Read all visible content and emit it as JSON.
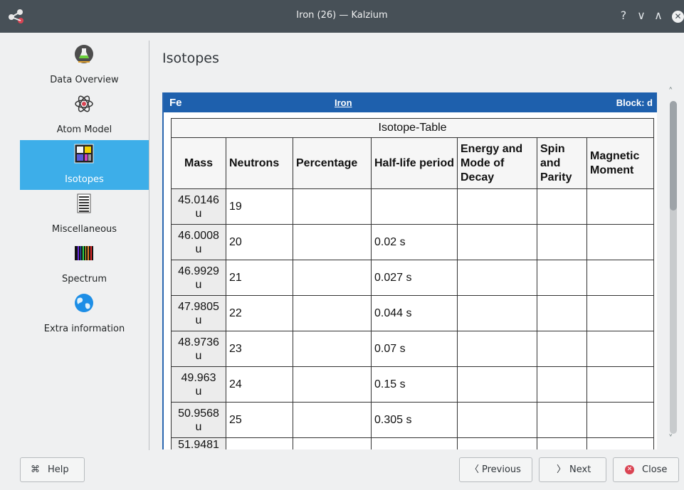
{
  "window": {
    "title": "Iron (26) — Kalzium",
    "controls": {
      "help": "?",
      "minimize": "∨",
      "maximize": "∧",
      "close": "✕"
    }
  },
  "sidebar": {
    "items": [
      {
        "label": "Data Overview",
        "icon": "flask-icon"
      },
      {
        "label": "Atom Model",
        "icon": "atom-icon"
      },
      {
        "label": "Isotopes",
        "icon": "isotopes-grid-icon",
        "selected": true
      },
      {
        "label": "Miscellaneous",
        "icon": "document-lines-icon"
      },
      {
        "label": "Spectrum",
        "icon": "spectrum-icon"
      },
      {
        "label": "Extra information",
        "icon": "globe-icon"
      }
    ]
  },
  "page": {
    "title": "Isotopes"
  },
  "element": {
    "symbol": "Fe",
    "name": "Iron",
    "block": "Block: d"
  },
  "isotope_table": {
    "caption": "Isotope-Table",
    "headers": {
      "mass": "Mass",
      "neutrons": "Neutrons",
      "percentage": "Percentage",
      "half_life": "Half-life period",
      "decay": "Energy and Mode of Decay",
      "spin": "Spin and Parity",
      "magnetic": "Magnetic Moment"
    },
    "rows": [
      {
        "mass": "45.0146",
        "unit": "u",
        "neutrons": "19",
        "percentage": "",
        "half_life": "",
        "decay": "",
        "spin": "",
        "magnetic": ""
      },
      {
        "mass": "46.0008",
        "unit": "u",
        "neutrons": "20",
        "percentage": "",
        "half_life": "0.02 s",
        "decay": "",
        "spin": "",
        "magnetic": ""
      },
      {
        "mass": "46.9929",
        "unit": "u",
        "neutrons": "21",
        "percentage": "",
        "half_life": "0.027 s",
        "decay": "",
        "spin": "",
        "magnetic": ""
      },
      {
        "mass": "47.9805",
        "unit": "u",
        "neutrons": "22",
        "percentage": "",
        "half_life": "0.044 s",
        "decay": "",
        "spin": "",
        "magnetic": ""
      },
      {
        "mass": "48.9736",
        "unit": "u",
        "neutrons": "23",
        "percentage": "",
        "half_life": "0.07 s",
        "decay": "",
        "spin": "",
        "magnetic": ""
      },
      {
        "mass": "49.963",
        "unit": "u",
        "neutrons": "24",
        "percentage": "",
        "half_life": "0.15 s",
        "decay": "",
        "spin": "",
        "magnetic": ""
      },
      {
        "mass": "50.9568",
        "unit": "u",
        "neutrons": "25",
        "percentage": "",
        "half_life": "0.305 s",
        "decay": "",
        "spin": "",
        "magnetic": ""
      },
      {
        "mass": "51.9481",
        "unit": "",
        "neutrons": "",
        "percentage": "",
        "half_life": "",
        "decay": "",
        "spin": "",
        "magnetic": ""
      }
    ]
  },
  "buttons": {
    "help": "Help",
    "previous": "Previous",
    "next": "Next",
    "close": "Close"
  },
  "colors": {
    "titlebar": "#475057",
    "selection": "#3daee9",
    "element_header": "#1e60ad",
    "close_icon": "#da4453"
  }
}
